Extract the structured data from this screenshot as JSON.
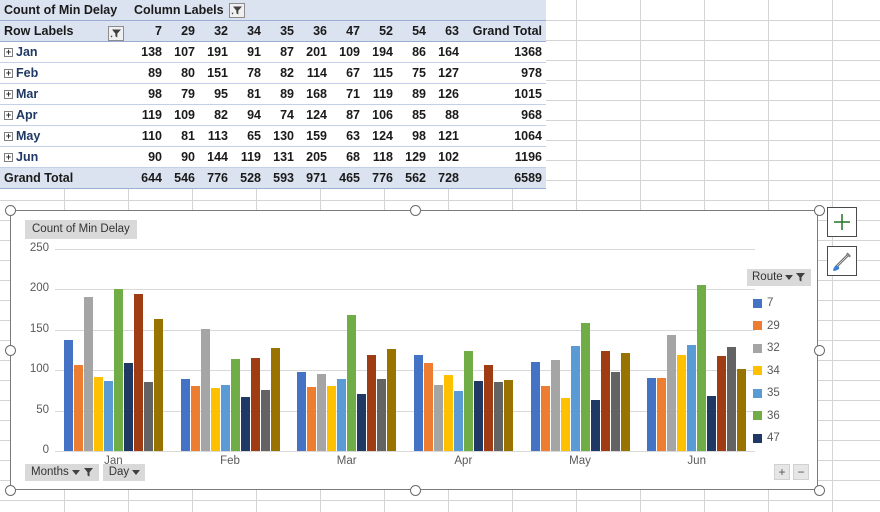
{
  "pivot": {
    "value_field_label": "Count of Min Delay",
    "column_labels_label": "Column Labels",
    "row_labels_label": "Row Labels",
    "grand_total_label": "Grand Total",
    "columns": [
      "7",
      "29",
      "32",
      "34",
      "35",
      "36",
      "47",
      "52",
      "54",
      "63"
    ],
    "rows": [
      {
        "label": "Jan",
        "values": [
          138,
          107,
          191,
          91,
          87,
          201,
          109,
          194,
          86,
          164
        ],
        "total": 1368
      },
      {
        "label": "Feb",
        "values": [
          89,
          80,
          151,
          78,
          82,
          114,
          67,
          115,
          75,
          127
        ],
        "total": 978
      },
      {
        "label": "Mar",
        "values": [
          98,
          79,
          95,
          81,
          89,
          168,
          71,
          119,
          89,
          126
        ],
        "total": 1015
      },
      {
        "label": "Apr",
        "values": [
          119,
          109,
          82,
          94,
          74,
          124,
          87,
          106,
          85,
          88
        ],
        "total": 968
      },
      {
        "label": "May",
        "values": [
          110,
          81,
          113,
          65,
          130,
          159,
          63,
          124,
          98,
          121
        ],
        "total": 1064
      },
      {
        "label": "Jun",
        "values": [
          90,
          90,
          144,
          119,
          131,
          205,
          68,
          118,
          129,
          102
        ],
        "total": 1196
      }
    ],
    "totals_row": {
      "label": "Grand Total",
      "values": [
        644,
        546,
        776,
        528,
        593,
        971,
        465,
        776,
        562,
        728
      ],
      "total": 6589
    }
  },
  "chart": {
    "title": "Count of Min Delay",
    "legend_title": "Route",
    "legend_items": [
      {
        "label": "7",
        "color": "#4472c4"
      },
      {
        "label": "29",
        "color": "#ed7d31"
      },
      {
        "label": "32",
        "color": "#a5a5a5"
      },
      {
        "label": "34",
        "color": "#ffc000"
      },
      {
        "label": "35",
        "color": "#5b9bd5"
      },
      {
        "label": "36",
        "color": "#70ad47"
      },
      {
        "label": "47",
        "color": "#1f3864"
      }
    ],
    "field_buttons": [
      {
        "label": "Months",
        "icon": "filter-icon"
      },
      {
        "label": "Day",
        "icon": "chevron-down-icon"
      }
    ],
    "expand_button": "+",
    "collapse_button": "−",
    "side_buttons": [
      {
        "name": "chart-elements-button",
        "icon": "plus-icon"
      },
      {
        "name": "chart-styles-button",
        "icon": "paintbrush-icon"
      }
    ]
  },
  "chart_data": {
    "type": "bar",
    "title": "Count of Min Delay",
    "xlabel": "",
    "ylabel": "",
    "categories": [
      "Jan",
      "Feb",
      "Mar",
      "Apr",
      "May",
      "Jun"
    ],
    "yticks": [
      0,
      50,
      100,
      150,
      200,
      250
    ],
    "ylim": [
      0,
      250
    ],
    "grid": true,
    "legend_position": "right",
    "series": [
      {
        "name": "7",
        "color": "#4472c4",
        "values": [
          138,
          89,
          98,
          119,
          110,
          90
        ]
      },
      {
        "name": "29",
        "color": "#ed7d31",
        "values": [
          107,
          80,
          79,
          109,
          81,
          90
        ]
      },
      {
        "name": "32",
        "color": "#a5a5a5",
        "values": [
          191,
          151,
          95,
          82,
          113,
          144
        ]
      },
      {
        "name": "34",
        "color": "#ffc000",
        "values": [
          91,
          78,
          81,
          94,
          65,
          119
        ]
      },
      {
        "name": "35",
        "color": "#5b9bd5",
        "values": [
          87,
          82,
          89,
          74,
          130,
          131
        ]
      },
      {
        "name": "36",
        "color": "#70ad47",
        "values": [
          201,
          114,
          168,
          124,
          159,
          205
        ]
      },
      {
        "name": "47",
        "color": "#1f3864",
        "values": [
          109,
          67,
          71,
          87,
          63,
          68
        ]
      },
      {
        "name": "52",
        "color": "#a03c13",
        "values": [
          194,
          115,
          119,
          106,
          124,
          118
        ]
      },
      {
        "name": "54",
        "color": "#636363",
        "values": [
          86,
          75,
          89,
          85,
          98,
          129
        ]
      },
      {
        "name": "63",
        "color": "#997300",
        "values": [
          164,
          127,
          126,
          88,
          121,
          102
        ]
      }
    ]
  }
}
